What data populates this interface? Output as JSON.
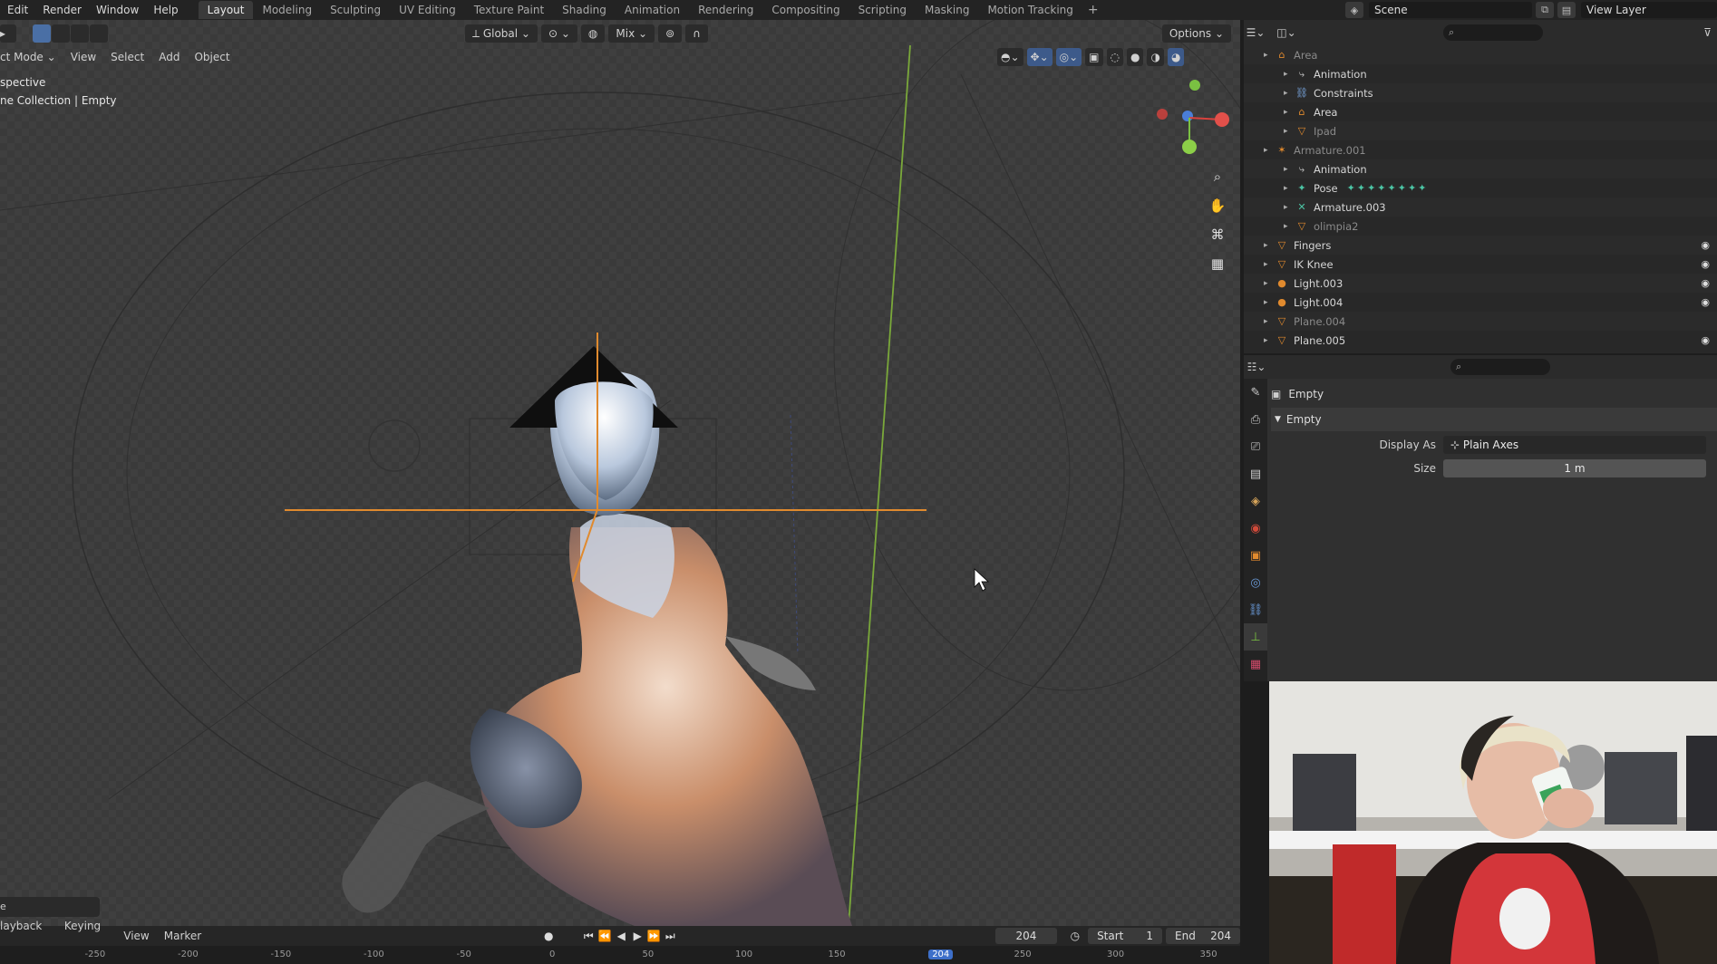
{
  "topbar": {
    "menu": [
      "Edit",
      "Render",
      "Window",
      "Help"
    ],
    "workspaces": [
      "Layout",
      "Modeling",
      "Sculpting",
      "UV Editing",
      "Texture Paint",
      "Shading",
      "Animation",
      "Rendering",
      "Compositing",
      "Scripting",
      "Masking",
      "Motion Tracking"
    ],
    "active_workspace": "Layout",
    "add_tab": "+",
    "scene": "Scene",
    "view_layer": "View Layer"
  },
  "viewport": {
    "mode": "ct Mode",
    "menus": [
      "View",
      "Select",
      "Add",
      "Object"
    ],
    "orientation": "Global",
    "snap": "Mix",
    "options": "Options",
    "overlay_line1": "spective",
    "overlay_line2": "ne Collection | Empty",
    "status_bottom_left": "e"
  },
  "outliner": {
    "rows": [
      {
        "label": "Area",
        "depth": 2,
        "icon": "area-icon",
        "dim": true,
        "eye": false
      },
      {
        "label": "Animation",
        "depth": 3,
        "icon": "animation-icon",
        "dim": false,
        "eye": false
      },
      {
        "label": "Constraints",
        "depth": 3,
        "icon": "constraint-icon",
        "dim": false,
        "eye": false
      },
      {
        "label": "Area",
        "depth": 3,
        "icon": "area-icon",
        "dim": false,
        "eye": false
      },
      {
        "label": "Ipad",
        "depth": 3,
        "icon": "mesh-icon",
        "dim": true,
        "eye": false
      },
      {
        "label": "Armature.001",
        "depth": 2,
        "icon": "armature-icon",
        "dim": true,
        "eye": false
      },
      {
        "label": "Animation",
        "depth": 3,
        "icon": "animation-icon",
        "dim": false,
        "eye": false
      },
      {
        "label": "Pose",
        "depth": 3,
        "icon": "pose-icon",
        "dim": false,
        "eye": false
      },
      {
        "label": "Armature.003",
        "depth": 3,
        "icon": "armature-data-icon",
        "dim": false,
        "eye": false
      },
      {
        "label": "olimpia2",
        "depth": 3,
        "icon": "mesh-icon",
        "dim": true,
        "eye": false
      },
      {
        "label": "Fingers",
        "depth": 2,
        "icon": "mesh-icon",
        "dim": false,
        "eye": true
      },
      {
        "label": "IK Knee",
        "depth": 2,
        "icon": "mesh-icon",
        "dim": false,
        "eye": true
      },
      {
        "label": "Light.003",
        "depth": 2,
        "icon": "light-icon",
        "dim": false,
        "eye": true
      },
      {
        "label": "Light.004",
        "depth": 2,
        "icon": "light-icon",
        "dim": false,
        "eye": true
      },
      {
        "label": "Plane.004",
        "depth": 2,
        "icon": "mesh-icon",
        "dim": true,
        "eye": false
      },
      {
        "label": "Plane.005",
        "depth": 2,
        "icon": "mesh-icon",
        "dim": false,
        "eye": true
      }
    ]
  },
  "properties": {
    "object_name": "Empty",
    "panel_title": "Empty",
    "display_as_label": "Display As",
    "display_as_value": "Plain Axes",
    "size_label": "Size",
    "size_value": "1 m"
  },
  "timeline": {
    "menus": [
      "layback",
      "Keying",
      "View",
      "Marker"
    ],
    "current_frame": "204",
    "start_label": "Start",
    "start_value": "1",
    "end_label": "End",
    "end_value": "204",
    "ruler_labels": [
      "-250",
      "-200",
      "-150",
      "-100",
      "-50",
      "0",
      "50",
      "100",
      "150",
      "204",
      "250",
      "300",
      "350"
    ],
    "current_frame_marker": "204"
  }
}
